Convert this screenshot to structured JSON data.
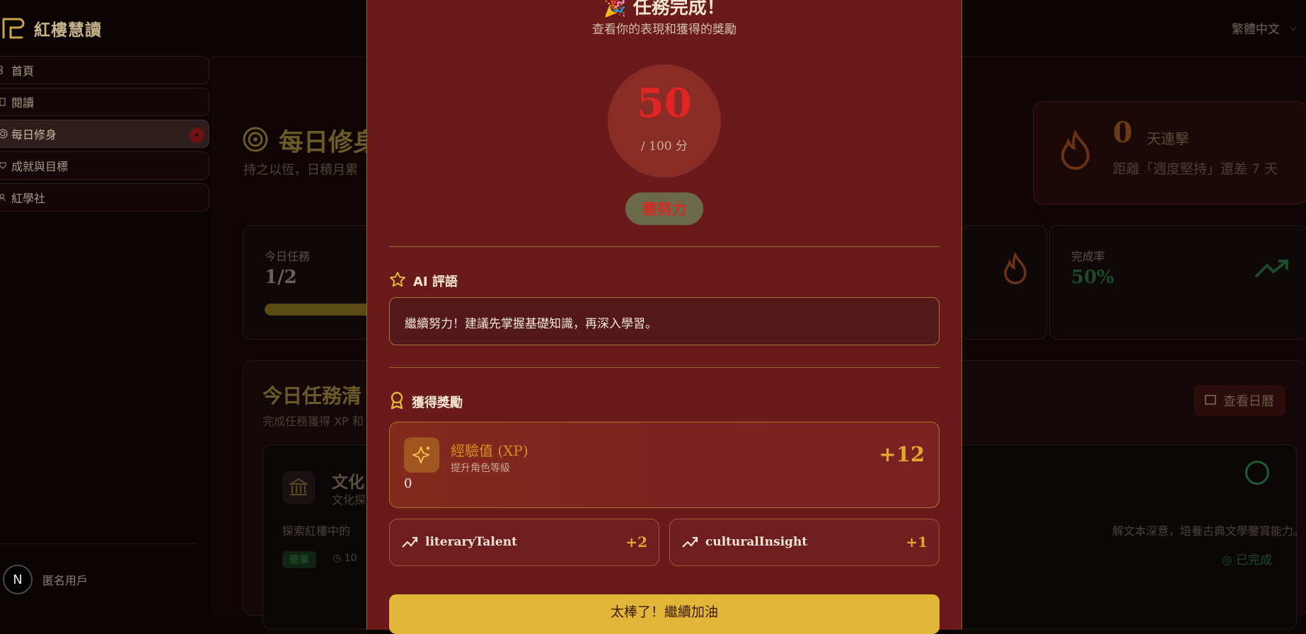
{
  "app": {
    "title": "紅樓慧讀",
    "language": "繁體中文"
  },
  "sidebar": {
    "items": [
      {
        "label": "首頁"
      },
      {
        "label": "閱讀"
      },
      {
        "label": "每日修身"
      },
      {
        "label": "成就與目標"
      },
      {
        "label": "紅學社"
      }
    ],
    "user": {
      "avatar": "N",
      "name": "匿名用戶"
    }
  },
  "page": {
    "title": "每日修身",
    "subtitle": "持之以恆，日積月累",
    "streak": {
      "value": "0",
      "unit": "天連擊",
      "hint": "距離「週度堅持」還差 7 天"
    },
    "stats": {
      "today_label": "今日任務",
      "today_value": "1/2",
      "rate_label": "完成率",
      "rate_value": "50%"
    },
    "list": {
      "title": "今日任務清",
      "subtitle": "完成任務獲得 XP 和",
      "calendar_button": "查看日曆",
      "task": {
        "title": "文化",
        "subtitle": "文化探",
        "desc_left": "探索紅樓中的",
        "desc_right": "解文本深意，培養古典文學鑒賞能力。",
        "tag": "簡單",
        "duration": "10",
        "status": "已完成"
      }
    }
  },
  "modal": {
    "title": "任務完成！",
    "subtitle": "查看你的表現和獲得的獎勵",
    "score": "50",
    "score_total": "/ 100 分",
    "level": "需努力",
    "ai_heading": "AI 評語",
    "ai_comment": "繼續努力！建議先掌握基礎知識，再深入學習。",
    "rewards_heading": "獲得獎勵",
    "xp": {
      "title": "經驗值 (XP)",
      "subtitle": "提升角色等級",
      "value": "+12",
      "current": "0"
    },
    "attributes": [
      {
        "name": "literaryTalent",
        "points": "+2"
      },
      {
        "name": "culturalInsight",
        "points": "+1"
      }
    ],
    "cta": "太棒了！繼續加油"
  },
  "colors": {
    "modal_bg": "#6a1a1a",
    "accent_gold": "#e2b638",
    "score_red": "#e32424"
  },
  "icons": [
    "logo-icon",
    "home-icon",
    "book-icon",
    "target-icon",
    "trophy-icon",
    "users-icon",
    "flame-icon",
    "trending-up-icon",
    "calendar-icon",
    "star-icon",
    "award-icon",
    "sparkles-icon",
    "check-circle-icon",
    "landmark-icon",
    "clock-icon",
    "chevron-down-icon"
  ]
}
